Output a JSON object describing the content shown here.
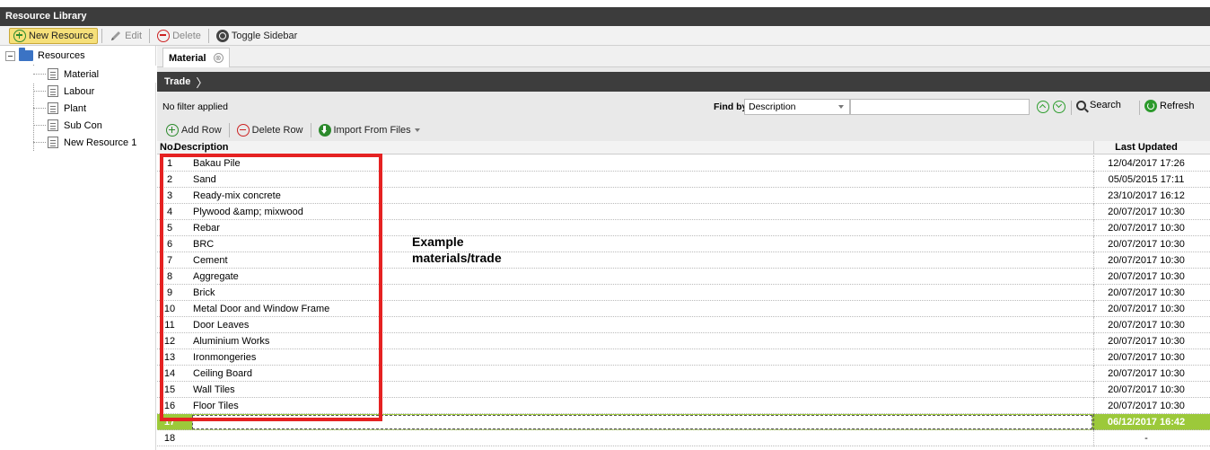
{
  "window": {
    "title": "Resource Library"
  },
  "toolbar": {
    "new_resource": "New Resource",
    "edit": "Edit",
    "delete": "Delete",
    "toggle_sidebar": "Toggle Sidebar"
  },
  "sidebar": {
    "root": "Resources",
    "items": [
      "Material",
      "Labour",
      "Plant",
      "Sub Con",
      "New Resource 1"
    ],
    "selected": "Material"
  },
  "tab": {
    "label": "Material",
    "close_glyph": "⊗"
  },
  "breadcrumb": {
    "label": "Trade",
    "arrow": "〉"
  },
  "filter": {
    "status": "No filter applied",
    "find_by_label": "Find by:",
    "find_by_value": "Description",
    "search_value": "",
    "search_label": "Search",
    "refresh_label": "Refresh"
  },
  "row_tools": {
    "add_row": "Add Row",
    "delete_row": "Delete Row",
    "import_from_files": "Import From Files"
  },
  "grid": {
    "headers": {
      "no": "No.",
      "description": "Description",
      "last_updated": "Last Updated"
    },
    "rows": [
      {
        "no": "1",
        "description": "Bakau Pile",
        "last_updated": "12/04/2017 17:26"
      },
      {
        "no": "2",
        "description": "Sand",
        "last_updated": "05/05/2015 17:11"
      },
      {
        "no": "3",
        "description": "Ready-mix concrete",
        "last_updated": "23/10/2017 16:12"
      },
      {
        "no": "4",
        "description": "Plywood &amp; mixwood",
        "last_updated": "20/07/2017 10:30"
      },
      {
        "no": "5",
        "description": "Rebar",
        "last_updated": "20/07/2017 10:30"
      },
      {
        "no": "6",
        "description": "BRC",
        "last_updated": "20/07/2017 10:30"
      },
      {
        "no": "7",
        "description": "Cement",
        "last_updated": "20/07/2017 10:30"
      },
      {
        "no": "8",
        "description": "Aggregate",
        "last_updated": "20/07/2017 10:30"
      },
      {
        "no": "9",
        "description": "Brick",
        "last_updated": "20/07/2017 10:30"
      },
      {
        "no": "10",
        "description": "Metal Door and Window Frame",
        "last_updated": "20/07/2017 10:30"
      },
      {
        "no": "11",
        "description": "Door Leaves",
        "last_updated": "20/07/2017 10:30"
      },
      {
        "no": "12",
        "description": "Aluminium Works",
        "last_updated": "20/07/2017 10:30"
      },
      {
        "no": "13",
        "description": "Ironmongeries",
        "last_updated": "20/07/2017 10:30"
      },
      {
        "no": "14",
        "description": "Ceiling Board",
        "last_updated": "20/07/2017 10:30"
      },
      {
        "no": "15",
        "description": "Wall Tiles",
        "last_updated": "20/07/2017 10:30"
      },
      {
        "no": "16",
        "description": "Floor Tiles",
        "last_updated": "20/07/2017 10:30"
      }
    ],
    "editing_row": {
      "no": "17",
      "description": "",
      "last_updated": "06/12/2017 16:42"
    },
    "next_row": {
      "no": "18",
      "last_updated": "-"
    }
  },
  "annotation": {
    "text_line1": "Example",
    "text_line2": "materials/trade",
    "color": "#e52222"
  },
  "colors": {
    "titlebar": "#3c3c3c",
    "highlight_row": "#9cc93a",
    "accent_green": "#2c8a2c"
  }
}
